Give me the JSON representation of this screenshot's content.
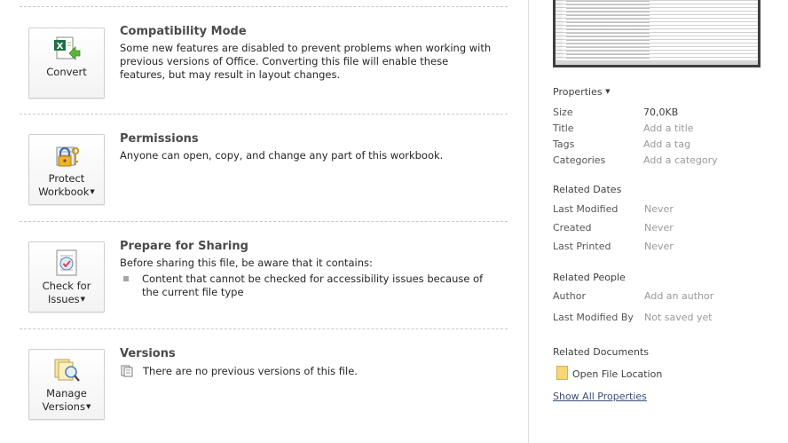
{
  "compat": {
    "button_label": "Convert",
    "title": "Compatibility Mode",
    "body": "Some new features are disabled to prevent problems when working with previous versions of Office. Converting this file will enable these features, but may result in layout changes."
  },
  "permissions": {
    "button_line1": "Protect",
    "button_line2": "Workbook",
    "title": "Permissions",
    "body": "Anyone can open, copy, and change any part of this workbook."
  },
  "sharing": {
    "button_line1": "Check for",
    "button_line2": "Issues",
    "title": "Prepare for Sharing",
    "intro": "Before sharing this file, be aware that it contains:",
    "bullet": "Content that cannot be checked for accessibility issues because of the current file type"
  },
  "versions": {
    "button_line1": "Manage",
    "button_line2": "Versions",
    "title": "Versions",
    "body": "There are no previous versions of this file."
  },
  "properties": {
    "header": "Properties",
    "items": [
      {
        "key": "Size",
        "value": "70,0KB"
      },
      {
        "key": "Title",
        "value": "Add a title"
      },
      {
        "key": "Tags",
        "value": "Add a tag"
      },
      {
        "key": "Categories",
        "value": "Add a category"
      }
    ]
  },
  "related_dates": {
    "header": "Related Dates",
    "items": [
      {
        "key": "Last Modified",
        "value": "Never"
      },
      {
        "key": "Created",
        "value": "Never"
      },
      {
        "key": "Last Printed",
        "value": "Never"
      }
    ]
  },
  "related_people": {
    "header": "Related People",
    "items": [
      {
        "key": "Author",
        "value": "Add an author"
      },
      {
        "key": "Last Modified By",
        "value": "Not saved yet"
      }
    ]
  },
  "related_documents": {
    "header": "Related Documents",
    "open_location": "Open File Location",
    "show_all": "Show All Properties"
  }
}
